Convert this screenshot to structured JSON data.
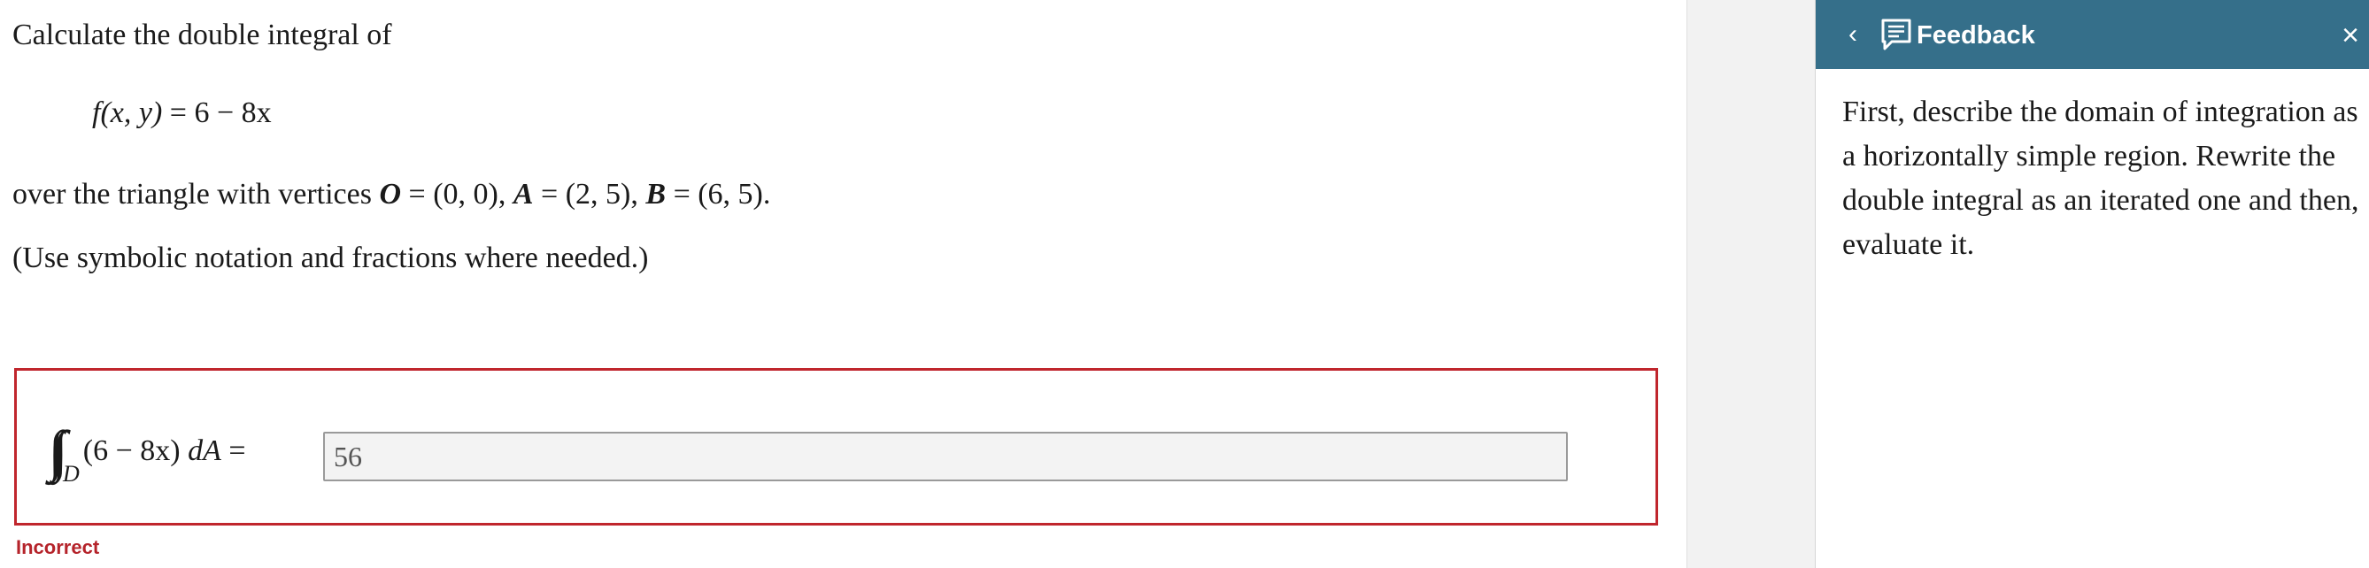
{
  "question": {
    "intro": "Calculate the double integral of",
    "function": {
      "lhs": "f(x, y)",
      "eq": "=",
      "rhs": "6 − 8x"
    },
    "region": {
      "prefix": "over the triangle with vertices ",
      "O_label": "O",
      "O_value": " = (0, 0), ",
      "A_label": "A",
      "A_value": " = (2, 5), ",
      "B_label": "B",
      "B_value": " = (6, 5)."
    },
    "hint": "(Use symbolic notation and fractions where needed.)"
  },
  "answer": {
    "integral_sign": "∫∫",
    "domain_label": "D",
    "integrand": "(6 − 8x) ",
    "differential": "dA",
    "equals": " =",
    "value": "56",
    "status": "Incorrect"
  },
  "feedback": {
    "back_glyph": "‹",
    "title": "Feedback",
    "close_glyph": "×",
    "body": "First, describe the domain of integration as a horizontally simple region. Rewrite the double integral as an iterated one and then, evaluate it."
  },
  "colors": {
    "error_red": "#c0262d",
    "feedback_header": "#356f8a",
    "gutter": "#f2f2f2"
  },
  "icons": {
    "back": "chevron-left-icon",
    "feedback": "feedback-icon",
    "close": "close-icon"
  }
}
